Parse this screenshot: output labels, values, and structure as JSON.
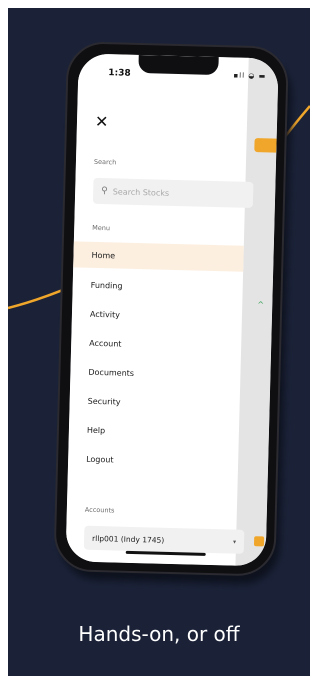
{
  "colors": {
    "background": "#1b2238",
    "accent": "#f0a62a",
    "active_item_bg": "#fcefe0",
    "success": "#3aa35b"
  },
  "status_bar": {
    "time": "1:38",
    "icons": "▪ll ◒ ▬"
  },
  "drawer": {
    "close_icon": "close-icon",
    "search_label": "Search",
    "search_placeholder": "Search Stocks",
    "menu_label": "Menu",
    "menu_items": [
      {
        "label": "Home",
        "active": true
      },
      {
        "label": "Funding",
        "active": false
      },
      {
        "label": "Activity",
        "active": false
      },
      {
        "label": "Account",
        "active": false
      },
      {
        "label": "Documents",
        "active": false
      },
      {
        "label": "Security",
        "active": false
      },
      {
        "label": "Help",
        "active": false
      },
      {
        "label": "Logout",
        "active": false
      }
    ],
    "accounts_label": "Accounts",
    "accounts_value": "rllp001 (Indy 1745)"
  },
  "tagline": "Hands-on, or off"
}
